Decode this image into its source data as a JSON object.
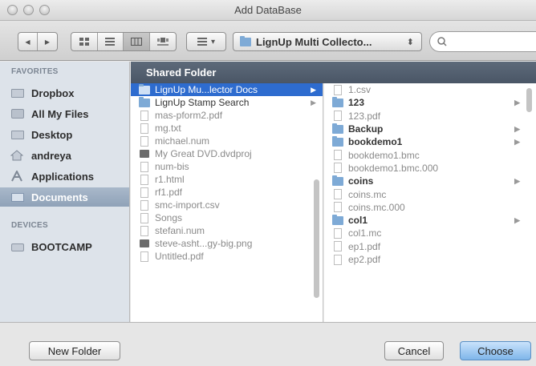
{
  "window": {
    "title": "Add DataBase"
  },
  "toolbar": {
    "back_glyph": "◀",
    "forward_glyph": "▶",
    "path_label": "LignUp Multi Collecto...",
    "path_stepper_glyph": "⬍",
    "search_placeholder": "",
    "arrange_glyph": "▾"
  },
  "sidebar": {
    "favorites_header": "FAVORITES",
    "devices_header": "DEVICES",
    "favorites": [
      {
        "label": "Dropbox",
        "icon": "folder-icon"
      },
      {
        "label": "All My Files",
        "icon": "all-files-icon"
      },
      {
        "label": "Desktop",
        "icon": "desktop-icon"
      },
      {
        "label": "andreya",
        "icon": "home-icon"
      },
      {
        "label": "Applications",
        "icon": "applications-icon"
      },
      {
        "label": "Documents",
        "icon": "documents-icon"
      }
    ],
    "devices": [
      {
        "label": "BOOTCAMP",
        "icon": "drive-icon"
      }
    ],
    "selected": "Documents"
  },
  "browser": {
    "header": "Shared Folder",
    "column1": [
      {
        "name": "LignUp Mu...lector Docs",
        "type": "folder",
        "has_children": true,
        "selected": true
      },
      {
        "name": "LignUp Stamp Search",
        "type": "folder",
        "has_children": true
      },
      {
        "name": "mas-pform2.pdf",
        "type": "doc"
      },
      {
        "name": "mg.txt",
        "type": "doc"
      },
      {
        "name": "michael.num",
        "type": "doc"
      },
      {
        "name": "My Great DVD.dvdproj",
        "type": "app"
      },
      {
        "name": "num-bis",
        "type": "doc"
      },
      {
        "name": "r1.html",
        "type": "doc"
      },
      {
        "name": "rf1.pdf",
        "type": "doc"
      },
      {
        "name": "smc-import.csv",
        "type": "doc"
      },
      {
        "name": "Songs",
        "type": "doc"
      },
      {
        "name": "stefani.num",
        "type": "doc"
      },
      {
        "name": "steve-asht...gy-big.png",
        "type": "doc"
      },
      {
        "name": "Untitled.pdf",
        "type": "doc"
      }
    ],
    "column2": [
      {
        "name": "1.csv",
        "type": "doc",
        "dim": true
      },
      {
        "name": "123",
        "type": "folder",
        "has_children": true
      },
      {
        "name": "123.pdf",
        "type": "doc",
        "dim": true
      },
      {
        "name": "Backup",
        "type": "folder",
        "has_children": true
      },
      {
        "name": "bookdemo1",
        "type": "folder",
        "has_children": true
      },
      {
        "name": "bookdemo1.bmc",
        "type": "doc",
        "dim": true
      },
      {
        "name": "bookdemo1.bmc.000",
        "type": "doc",
        "dim": true
      },
      {
        "name": "coins",
        "type": "folder",
        "has_children": true
      },
      {
        "name": "coins.mc",
        "type": "doc",
        "dim": true
      },
      {
        "name": "coins.mc.000",
        "type": "doc",
        "dim": true
      },
      {
        "name": "col1",
        "type": "folder",
        "has_children": true
      },
      {
        "name": "col1.mc",
        "type": "doc",
        "dim": true
      },
      {
        "name": "ep1.pdf",
        "type": "doc",
        "dim": true
      },
      {
        "name": "ep2.pdf",
        "type": "doc",
        "dim": true
      }
    ]
  },
  "buttons": {
    "new_folder": "New Folder",
    "cancel": "Cancel",
    "choose": "Choose"
  },
  "colors": {
    "selection": "#2e6ccf",
    "sidebar_bg": "#dde3ea",
    "header_bg": "#4f5b6b",
    "primary_button": "#8cbdee"
  }
}
